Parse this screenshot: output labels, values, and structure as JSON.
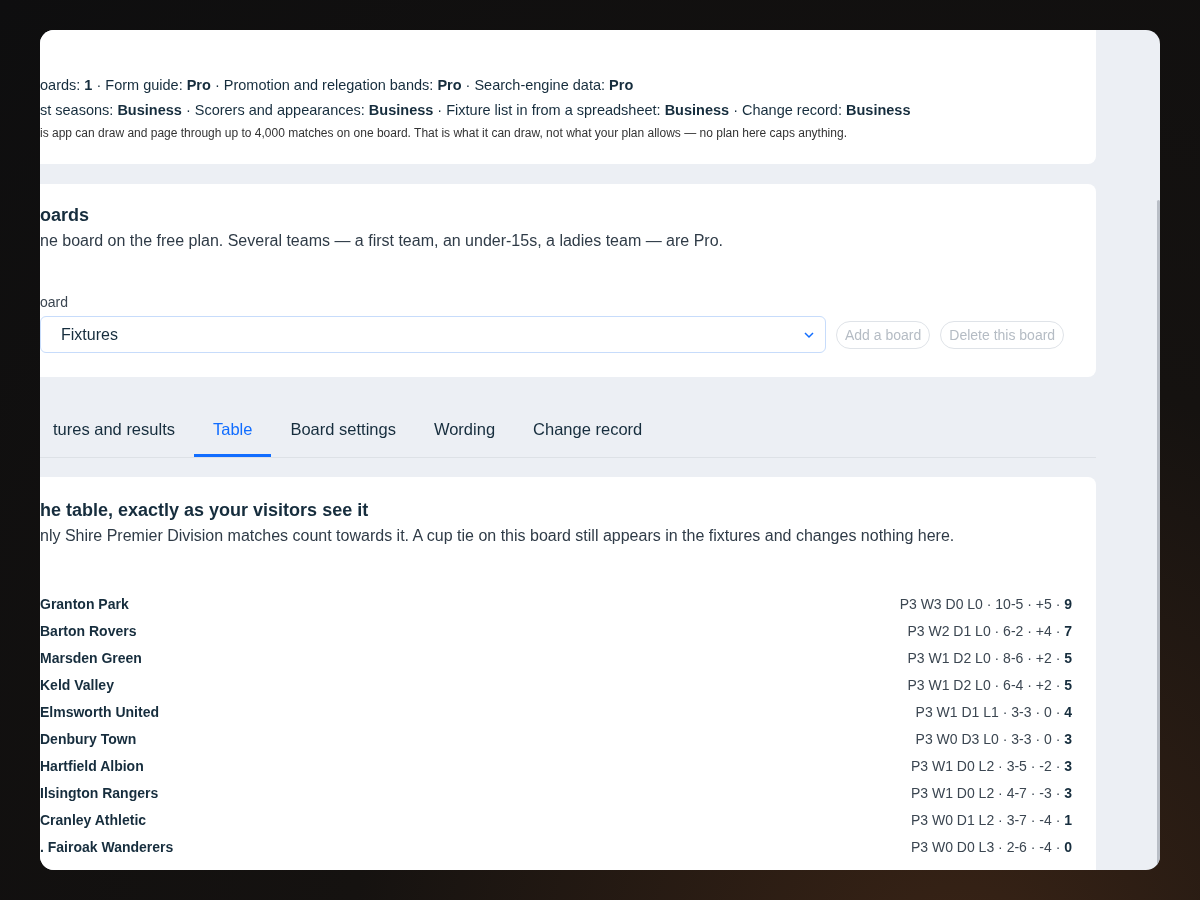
{
  "plan_summary": {
    "lines": [
      "oards: **1** · Form guide: **Pro** · Promotion and relegation bands: **Pro** · Search-engine data: **Pro**",
      "st seasons: **Business** · Scorers and appearances: **Business** · Fixture list in from a spreadsheet: **Business** · Change record: **Business**"
    ],
    "note": "is app can draw and page through up to 4,000 matches on one board. That is what it can draw, not what your plan allows — no plan here caps anything."
  },
  "boards": {
    "title": "oards",
    "description": "ne board on the free plan. Several teams — a first team, an under-15s, a ladies team — are Pro.",
    "select": {
      "label": "oard",
      "value": "Fixtures"
    },
    "buttons": [
      {
        "label": "Add a board",
        "disabled": true
      },
      {
        "label": "Delete this board",
        "disabled": true
      }
    ]
  },
  "tabs": [
    {
      "label": "tures and results",
      "selected": false
    },
    {
      "label": "Table",
      "selected": true
    },
    {
      "label": "Board settings",
      "selected": false
    },
    {
      "label": "Wording",
      "selected": false
    },
    {
      "label": "Change record",
      "selected": false
    }
  ],
  "table_panel": {
    "title": "he table, exactly as your visitors see it",
    "description": "nly Shire Premier Division matches count towards it. A cup tie on this board still appears in the fixtures and changes nothing here.",
    "rows": [
      {
        "team": "Granton Park",
        "record": "P3 W3 D0 L0 · 10-5 · +5 · **9**"
      },
      {
        "team": "Barton Rovers",
        "record": "P3 W2 D1 L0 · 6-2 · +4 · **7**"
      },
      {
        "team": "Marsden Green",
        "record": "P3 W1 D2 L0 · 8-6 · +2 · **5**"
      },
      {
        "team": "Keld Valley",
        "record": "P3 W1 D2 L0 · 6-4 · +2 · **5**"
      },
      {
        "team": "Elmsworth United",
        "record": "P3 W1 D1 L1 · 3-3 · 0 · **4**"
      },
      {
        "team": "Denbury Town",
        "record": "P3 W0 D3 L0 · 3-3 · 0 · **3**"
      },
      {
        "team": "Hartfield Albion",
        "record": "P3 W1 D0 L2 · 3-5 · -2 · **3**"
      },
      {
        "team": "Ilsington Rangers",
        "record": "P3 W1 D0 L2 · 4-7 · -3 · **3**"
      },
      {
        "team": "Cranley Athletic",
        "record": "P3 W0 D1 L2 · 3-7 · -4 · **1**"
      },
      {
        "team": ". Fairoak Wanderers",
        "record": "P3 W0 D0 L3 · 2-6 · -4 · **0**"
      }
    ]
  }
}
